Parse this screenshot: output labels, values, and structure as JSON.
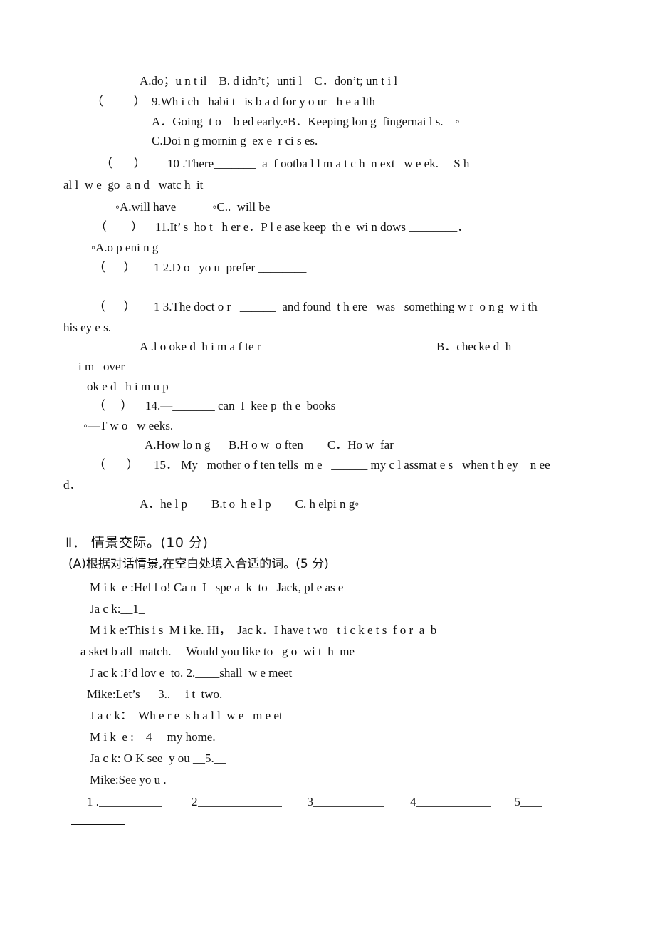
{
  "document": {
    "type": "scanned-exam-paper",
    "page_background": "#ffffff",
    "text_color": "#111111"
  },
  "multiple_choice": {
    "q8_options_line": "A.do；u n t il    B. d idn’t；unti l    C．don’t; un t i l",
    "questions": [
      {
        "number": "9",
        "paren": "（          ）",
        "stem": "9.Wh i ch   habi t   is b a d for y o ur   h e a lth",
        "option_lines": [
          "A．Going  t o    b ed early.◦B．Keeping lon g  fingernai l s.　◦",
          "C.Doi n g mornin g  ex e  r ci s es."
        ]
      },
      {
        "number": "10",
        "paren": "（       ）",
        "stem_line1": "10 .There_______  a  f ootba l l m a t c h  n ext   w e ek.　 S h",
        "stem_line2": "al l  w e  go  a n d   watc h  it",
        "option_lines": [
          "◦A.will have            ◦C..  will be"
        ]
      },
      {
        "number": "11",
        "paren": "（        ）",
        "stem": "11.It’ s  ho t   h er e．P l e ase keep  th e  wi n dows ________．",
        "option_lines": [
          "◦A.o p eni n g"
        ]
      },
      {
        "number": "12",
        "paren": "（      ）",
        "stem": "1 2.D o   yo u  prefer ________",
        "option_lines": []
      },
      {
        "number": "13",
        "paren": "（      ）",
        "stem_line1": "1 3.The doct o r   ______  and found  t h ere   was   something w r  o n g  w i th",
        "stem_line2": "his ey e s.",
        "option_lines": [
          "A .l o oke d  h i m a f te r                                                          B．checke d  h",
          "i m   over",
          "ok e d   h i m u p"
        ]
      },
      {
        "number": "14",
        "paren": "（     ）",
        "stem_line1": "14.—_______ can  I  kee p  th e  books",
        "stem_line2": "◦—T w o   w eeks.",
        "option_lines": [
          "A.How lo n g      B.H o w  o ften        C．Ho w  far"
        ]
      },
      {
        "number": "15",
        "paren": "（       ）",
        "stem_line1": "15． My   mother o f ten tells  m e   ______ my c l assmat e s   when t h ey    n ee",
        "stem_line2": "d．",
        "option_lines": [
          "A．he l p        B.t o  h e l p        C. h elpi n g◦"
        ]
      }
    ]
  },
  "section_two": {
    "heading": "Ⅱ． 情景交际。(10 分)",
    "subheading": "(A)根据对话情景,在空白处填入合适的词。(5 分)",
    "dialogue": [
      {
        "speaker_line": "M i k  e :Hel l o! Ca n  I   spe a  k  to   Jack, pl e as e"
      },
      {
        "speaker_line": "Ja c k:__1_"
      },
      {
        "speaker_line": "M i k e:This i s  M i ke. Hi，  Jac k．I have t wo   t i c k e t s  f o r  a  b"
      },
      {
        "speaker_line": "a sket b all  match.　 Would you like to   g o  wi t  h  me"
      },
      {
        "speaker_line": "J ac k :I’d lov e  to. 2.____shall  w e meet"
      },
      {
        "speaker_line": "Mike:Let’s  __3..__ i t  two."
      },
      {
        "speaker_line": "J a c k：  Wh e r e  s h a l l  w e   m e et"
      },
      {
        "speaker_line": "M i k  e :__4__ my home."
      },
      {
        "speaker_line": "Ja c k: O K see  y ou __5.__"
      },
      {
        "speaker_line": "Mike:See yo u ."
      }
    ],
    "answer_blanks": [
      {
        "label": "1 ."
      },
      {
        "label": "2"
      },
      {
        "label": "3"
      },
      {
        "label": "4"
      },
      {
        "label": "5"
      }
    ]
  }
}
